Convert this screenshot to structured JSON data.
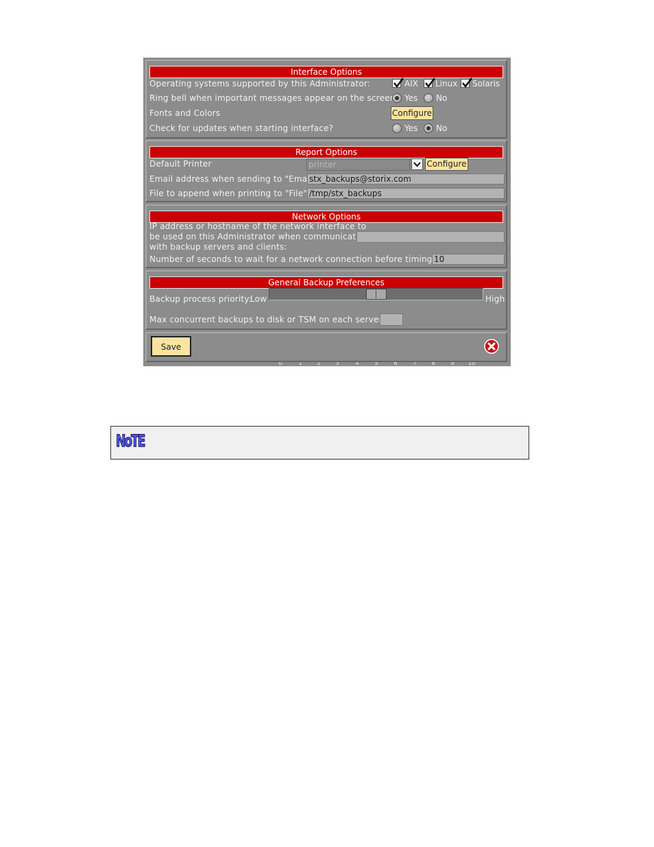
{
  "interface_options": {
    "title": "Interface Options",
    "os_label": "Operating systems supported by this Administrator:",
    "os_options": [
      "AIX",
      "Linux",
      "Solaris"
    ],
    "os_checked": [
      true,
      true,
      true
    ],
    "bell_label": "Ring bell when important messages appear on the screen?",
    "bell_value": "Yes",
    "fonts_label": "Fonts and Colors",
    "configure_label": "Configure",
    "updates_label": "Check for updates when starting interface?",
    "updates_value": "No",
    "yes_label": "Yes",
    "no_label": "No"
  },
  "report_options": {
    "title": "Report Options",
    "printer_label": "Default Printer",
    "printer_value": "printer",
    "configure_label": "Configure",
    "email_label": "Email address when sending to \"Email\"",
    "email_value": "stx_backups@storix.com",
    "file_label": "File to append when printing to \"File\"",
    "file_value": "/tmp/stx_backups"
  },
  "network_options": {
    "title": "Network Options",
    "ip_label_lines": [
      "IP address or hostname of the network interface to",
      "be used on this Administrator when communicating",
      "with backup servers and clients:"
    ],
    "ip_value": "",
    "timeout_label": "Number of seconds to wait for a network connection before timing out:",
    "timeout_value": "10"
  },
  "backup_prefs": {
    "title": "General Backup Preferences",
    "priority_label": "Backup process priority:",
    "low_label": "Low",
    "high_label": "High",
    "priority_value": 5,
    "ticks": [
      "0",
      "1",
      "2",
      "3",
      "4",
      "5",
      "6",
      "7",
      "8",
      "9",
      "10"
    ],
    "concurrent_label": "Max concurrent backups to disk or TSM on each server:",
    "concurrent_value": ""
  },
  "footer": {
    "save_label": "Save",
    "close_icon": "close-icon"
  },
  "note": {
    "icon_text": "NoTE"
  },
  "colors": {
    "dialog_bg": "#8c8c8c",
    "header_red": "#cc0000",
    "button_yellow": "#fbe4a0",
    "close_red": "#cc1111"
  }
}
